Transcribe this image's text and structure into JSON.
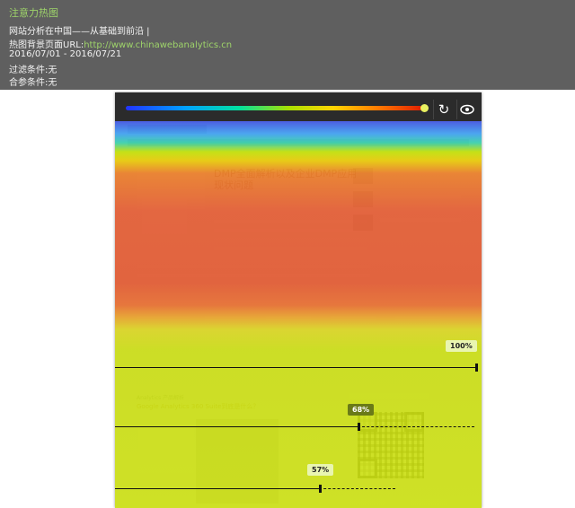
{
  "header": {
    "title": "注意力热图",
    "site_line": "网站分析在中国——从基础到前沿 |",
    "url_label": "热图背景页面URL:",
    "url_value": "http://www.chinawebanalytics.cn",
    "date_range": "2016/07/01 - 2016/07/21",
    "filter_condition": "过滤条件:无",
    "participation_condition": "合参条件:无"
  },
  "toolbar": {
    "refresh_icon": "refresh-icon",
    "eye_icon": "eye-icon",
    "scale_colors": [
      "#2233ff",
      "#00a0ff",
      "#00e0a0",
      "#a8e000",
      "#ffd400",
      "#ff7a00",
      "#e02000"
    ]
  },
  "heatmap": {
    "fold_markers": [
      {
        "label": "100%"
      },
      {
        "label": "68%"
      },
      {
        "label": "57%"
      }
    ]
  }
}
